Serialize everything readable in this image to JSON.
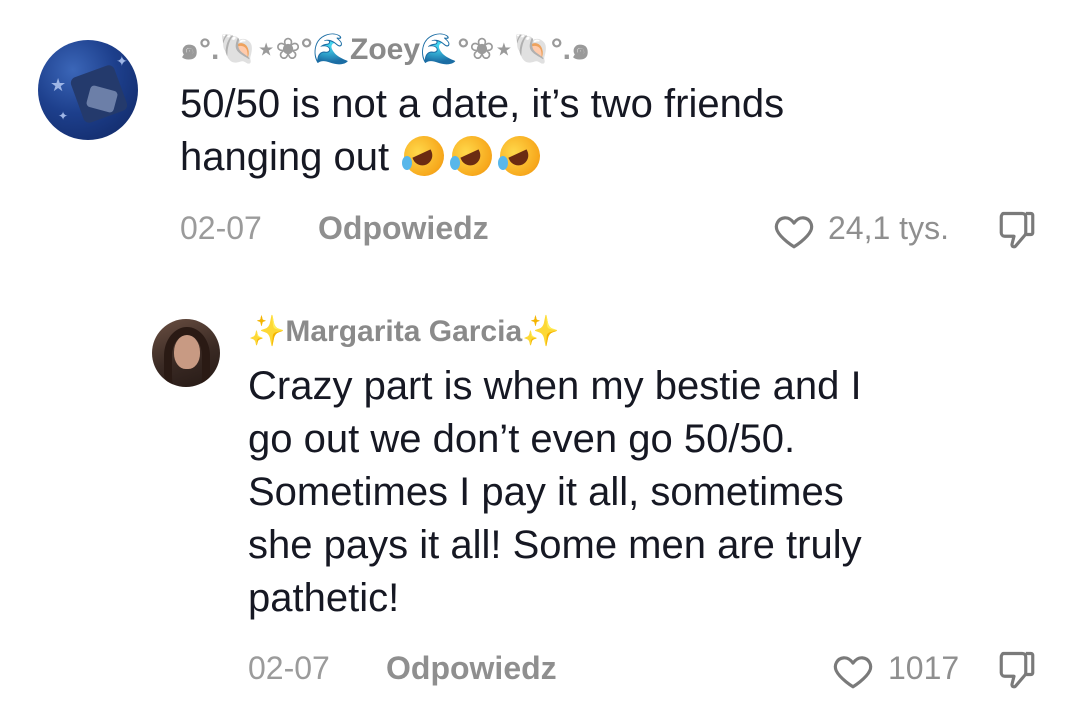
{
  "comments": [
    {
      "username": {
        "prefix": "๑°.",
        "shell1": "🐚",
        "mid1": "⋆❀°",
        "wave1": "🌊",
        "name": "Zoey",
        "wave2": "🌊",
        "mid2": "°❀⋆",
        "shell2": "🐚",
        "suffix": "°.๑"
      },
      "text_line1": "50/50 is not a date, it’s two friends",
      "text_line2": "hanging out",
      "date": "02-07",
      "reply_label": "Odpowiedz",
      "likes": "24,1 tys.",
      "icons": [
        "avatar",
        "rolling-on-floor-laughing-emoji",
        "heart-icon",
        "thumbs-down-icon"
      ]
    },
    {
      "username": {
        "spark1": "✨",
        "name": "Margarita Garcia",
        "spark2": "✨"
      },
      "text_lines": [
        "Crazy part is when my bestie and I",
        "go out we don’t even go 50/50.",
        "Sometimes I pay it all, sometimes",
        "she pays it all! Some men are truly",
        "pathetic!"
      ],
      "date": "02-07",
      "reply_label": "Odpowiedz",
      "likes": "1017",
      "icons": [
        "avatar",
        "heart-icon",
        "thumbs-down-icon"
      ]
    }
  ],
  "colors": {
    "text": "#161823",
    "muted": "#8f8f8f",
    "background": "#ffffff"
  }
}
